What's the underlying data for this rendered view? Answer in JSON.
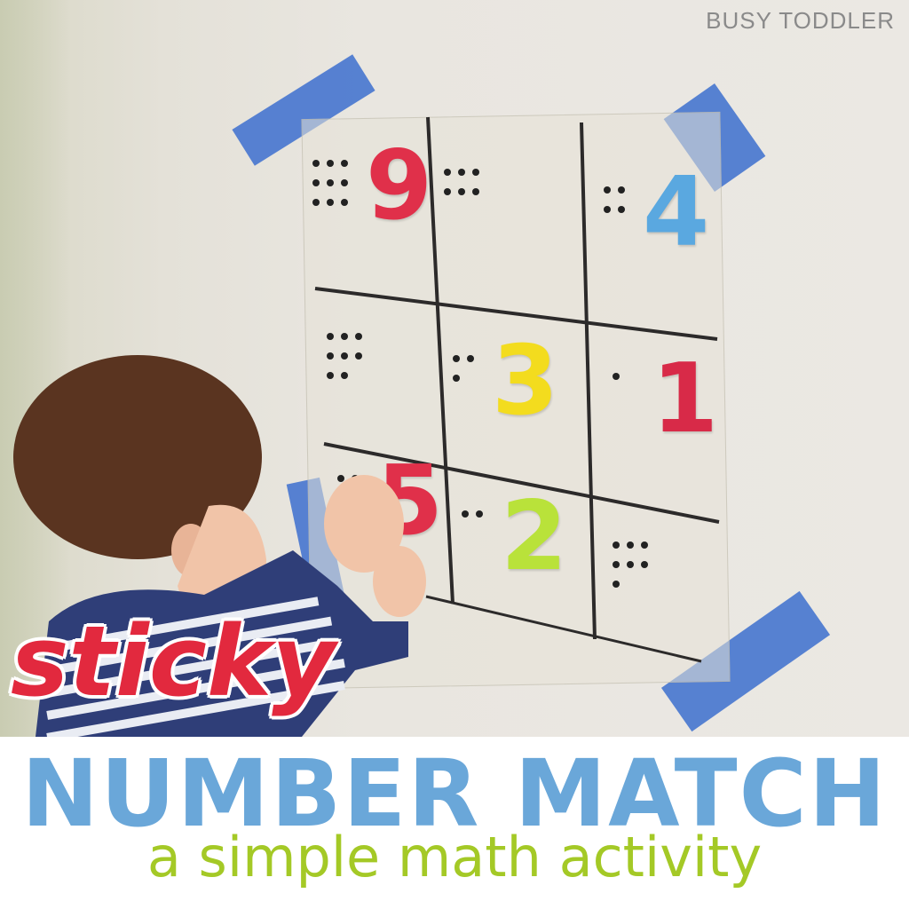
{
  "watermark": "BUSY TODDLER",
  "overlay": {
    "word": "sticky",
    "title": "NUMBER MATCH",
    "subtitle": "a simple math activity"
  },
  "grid_cells": [
    {
      "digit": "9",
      "color": "#e0304a",
      "dots": 9
    },
    {
      "digit": "",
      "color": "",
      "dots": 6
    },
    {
      "digit": "4",
      "color": "#5aa8e0",
      "dots": 4
    },
    {
      "digit": "",
      "color": "",
      "dots": 8
    },
    {
      "digit": "3",
      "color": "#f3dc1e",
      "dots": 3
    },
    {
      "digit": "1",
      "color": "#d82a48",
      "dots": 1
    },
    {
      "digit": "5",
      "color": "#e0304a",
      "dots": 5
    },
    {
      "digit": "2",
      "color": "#b9e23a",
      "dots": 2
    },
    {
      "digit": "",
      "color": "",
      "dots": 7
    }
  ],
  "colors": {
    "tape": "#4a78d0",
    "title": "#6aa7d9",
    "subtitle": "#a4c926",
    "sticky": "#e2293e",
    "shirt_stripe_dark": "#2f3e78",
    "shirt_stripe_light": "#e9ecf3",
    "hair": "#5a3420",
    "skin": "#f1c4a8"
  }
}
